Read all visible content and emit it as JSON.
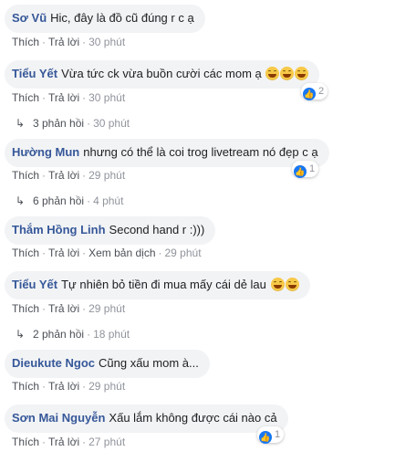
{
  "actions": {
    "like": "Thích",
    "reply": "Trả lời",
    "sep": "·",
    "edit_history": "Xem bản dịch"
  },
  "comments": [
    {
      "author": "Sơ Vũ",
      "text": "Hic, đây là đồ cũ đúng r c ạ",
      "time": "30 phút"
    },
    {
      "author": "Tiểu Yết",
      "text": "Vừa tức ck vừa buồn cười các mom ạ",
      "time": "30 phút",
      "reactions": "2",
      "replies": "3 phản hồi",
      "replies_time": "30 phút"
    },
    {
      "author": "Hường Mun",
      "text": "nhưng có thể là coi trog livetream nó đẹp c ạ",
      "time": "29 phút",
      "reactions": "1",
      "replies": "6 phản hồi",
      "replies_time": "4 phút"
    },
    {
      "author": "Thắm Hồng Linh",
      "text": "Second hand r :)))",
      "time": "29 phút"
    },
    {
      "author": "Tiểu Yết",
      "text": "Tự nhiên bỏ tiền đi mua mấy cái dẻ lau",
      "time": "29 phút",
      "replies": "2 phản hồi",
      "replies_time": "18 phút"
    },
    {
      "author": "Dieukute Ngoc",
      "text": "Cũng xấu mom à...",
      "time": "29 phút"
    },
    {
      "author": "Sơn Mai Nguyễn",
      "text": "Xấu lắm không được cái nào cả",
      "time": "27 phút",
      "reactions": "1"
    }
  ],
  "icons": {
    "emoji": "laughing-emoji-icon",
    "like": "like-icon",
    "reply_arrow": "reply-arrow-icon"
  },
  "colors": {
    "author": "#365899",
    "bubble": "#f2f3f5",
    "meta": "#90949c",
    "like": "#1877f2"
  }
}
